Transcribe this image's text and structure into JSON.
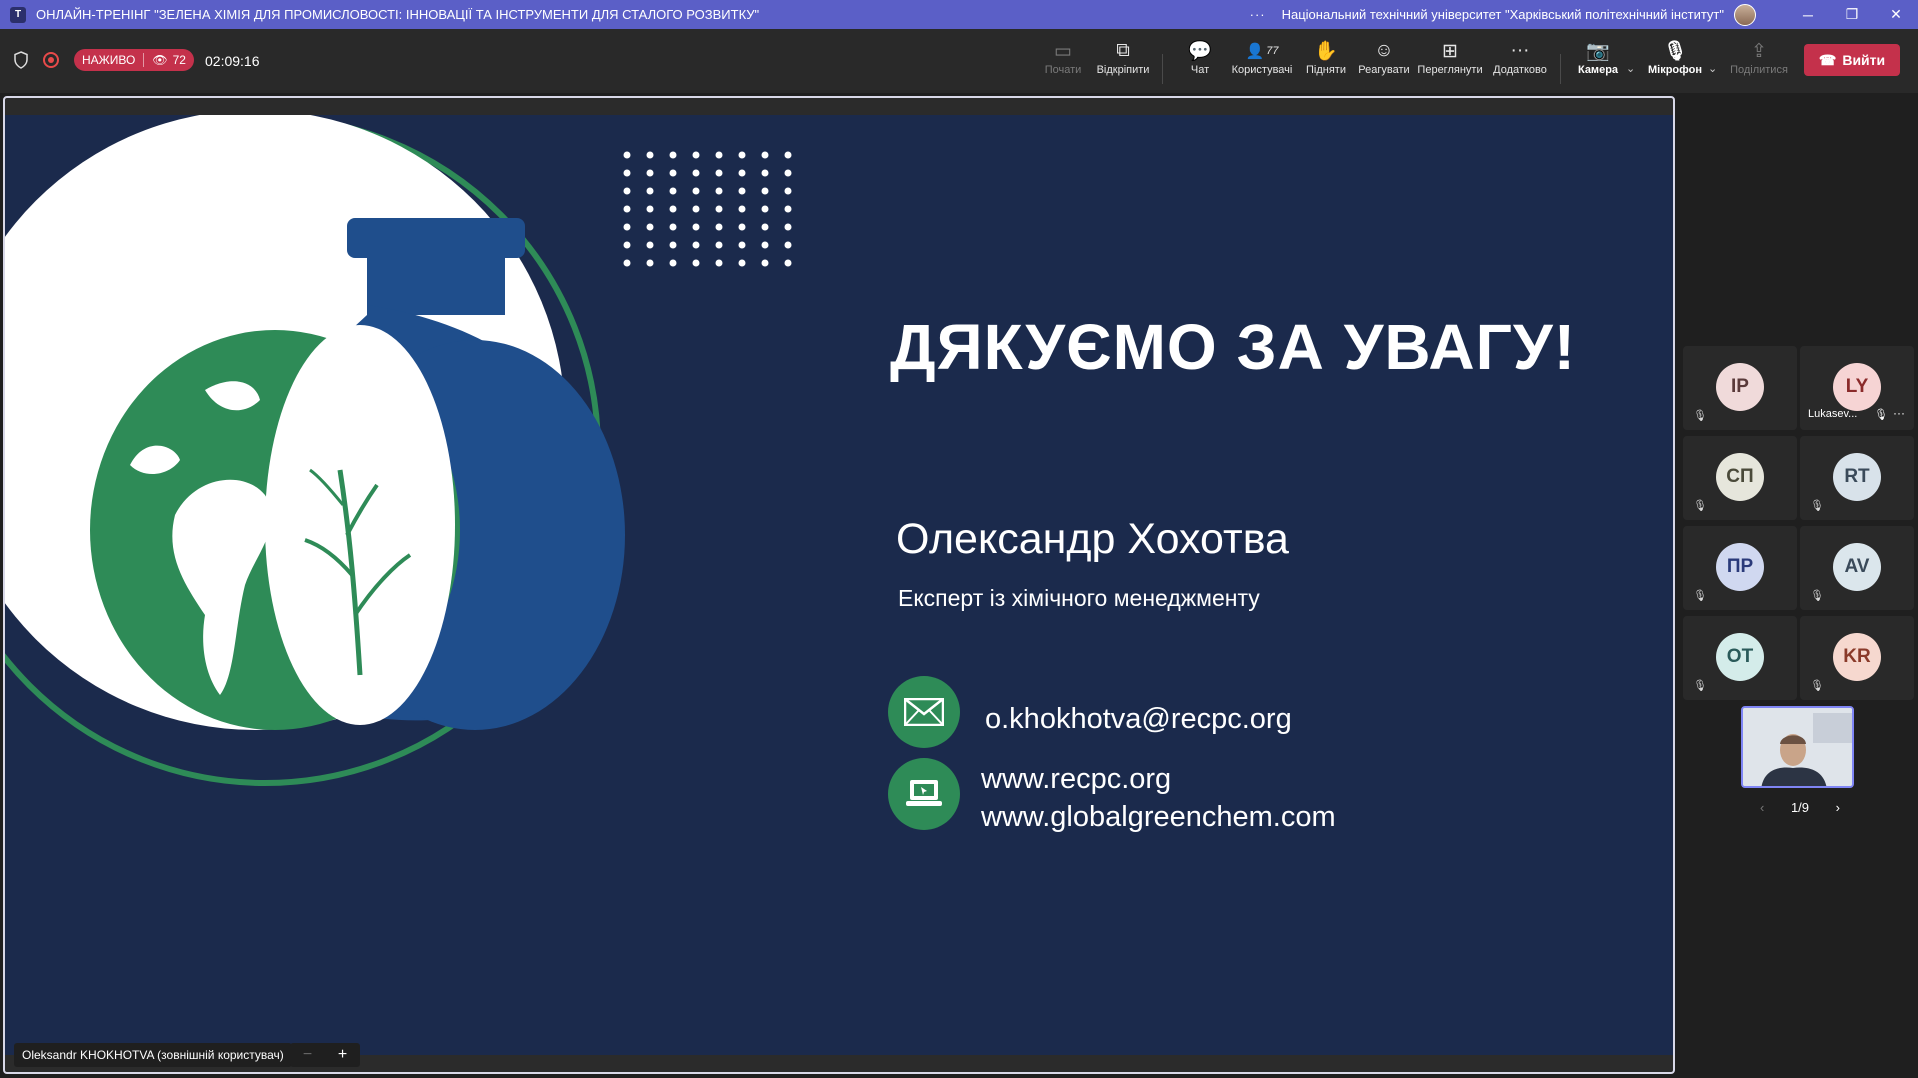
{
  "titlebar": {
    "title": "ОНЛАЙН-ТРЕНІНГ \"ЗЕЛЕНА ХІМІЯ ДЛЯ ПРОМИСЛОВОСТІ: ІННОВАЦІЇ ТА ІНСТРУМЕНТИ ДЛЯ СТАЛОГО РОЗВИТКУ\"",
    "more": "···",
    "organization": "Національний технічний університет \"Харківський політехнічний інститут\"",
    "minimize": "─",
    "restore": "❐",
    "close": "✕"
  },
  "toolbar": {
    "live_label": "НАЖИВО",
    "viewers": "72",
    "elapsed": "02:09:16",
    "start_label": "Почати",
    "popout_label": "Відкріпити",
    "chat_label": "Чат",
    "people_label": "Користувачі",
    "people_count": "77",
    "raise_label": "Підняти",
    "react_label": "Реагувати",
    "view_label": "Переглянути",
    "more_label": "Додатково",
    "camera_label": "Камера",
    "mic_label": "Мікрофон",
    "share_label": "Поділитися",
    "leave_label": "Вийти"
  },
  "slide": {
    "heading": "ДЯКУЄМО ЗА УВАГУ!",
    "speaker": "Олександр Хохотва",
    "role": "Експерт із хімічного менеджменту",
    "email": "o.khokhotva@recpc.org",
    "website1": "www.recpc.org",
    "website2": "www.globalgreenchem.com"
  },
  "stage": {
    "presenter": "Oleksandr KHOKHOTVA (зовнішній користувач)",
    "zoom_out": "−",
    "zoom_in": "+"
  },
  "participants": [
    {
      "initials": "IP",
      "bg": "#f0dada",
      "fg": "#5a3a3a"
    },
    {
      "initials": "LY",
      "bg": "#f6d4d4",
      "fg": "#8a2a2a",
      "name": "Lukasev..."
    },
    {
      "initials": "СП",
      "bg": "#e6e6dc",
      "fg": "#4a4a3a"
    },
    {
      "initials": "RT",
      "bg": "#d8e2ea",
      "fg": "#3a4a5a"
    },
    {
      "initials": "ПР",
      "bg": "#d0d8f0",
      "fg": "#2a3a7a"
    },
    {
      "initials": "AV",
      "bg": "#dbe6ec",
      "fg": "#3a4a5a"
    },
    {
      "initials": "OT",
      "bg": "#d4ecea",
      "fg": "#2a5a5a"
    },
    {
      "initials": "KR",
      "bg": "#f6d8cf",
      "fg": "#8a3a2a"
    }
  ],
  "pager": {
    "prev": "‹",
    "label": "1/9",
    "next": "›"
  },
  "colors": {
    "brand": "#5b5fc7",
    "live": "#c4314b",
    "slide_bg": "#1b2a4c",
    "green": "#2e8b57",
    "blue": "#1f4e8c"
  }
}
